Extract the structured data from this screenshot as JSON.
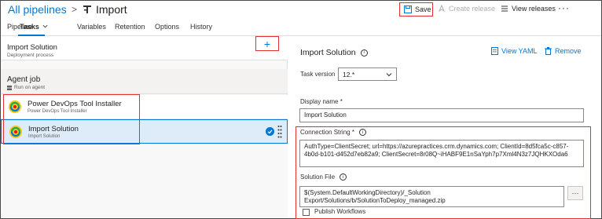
{
  "header": {
    "breadcrumb_root": "All pipelines",
    "breadcrumb_sep": ">",
    "pipeline_title": "Import",
    "save_label": "Save",
    "create_release_label": "Create release",
    "view_releases_label": "View releases",
    "more_label": "···"
  },
  "tabs": [
    {
      "label": "Pipeline"
    },
    {
      "label": "Tasks"
    },
    {
      "label": "Variables"
    },
    {
      "label": "Retention"
    },
    {
      "label": "Options"
    },
    {
      "label": "History"
    }
  ],
  "stage": {
    "title": "Import Solution",
    "subtitle": "Deployment process",
    "more": "···"
  },
  "agent_job": {
    "title": "Agent job",
    "subtitle": "Run on agent",
    "add_label": "+"
  },
  "tasks": [
    {
      "name": "Power DevOps Tool Installer",
      "sub": "Power DevOps Tool Installer"
    },
    {
      "name": "Import Solution",
      "sub": "Import Solution"
    }
  ],
  "details": {
    "title": "Import Solution",
    "view_yaml_label": "View YAML",
    "remove_label": "Remove",
    "task_version_label": "Task version",
    "task_version_value": "12.*",
    "display_name_label": "Display name *",
    "display_name_value": "Import Solution",
    "connection_string_label": "Connection String *",
    "connection_string_value": "AuthType=ClientSecret; url=https://azurepractices.crm.dynamics.com; ClientId=8d5fca5c-c857-4b0d-b101-d452d7eb82a9; ClientSecret=8r08Q~iHABF9E1nSaYph7p7Xml4N3z7JQHKXOda6",
    "solution_file_label": "Solution File",
    "solution_file_value": "$(System.DefaultWorkingDirectory)/_Solution Export/Solutions/b/SolutionToDeploy_managed.zip",
    "browse_label": "···",
    "publish_workflows_label": "Publish Workflows"
  },
  "colors": {
    "accent": "#0078d4",
    "highlight_box": "#e03030",
    "selected_row": "#deecf9"
  }
}
